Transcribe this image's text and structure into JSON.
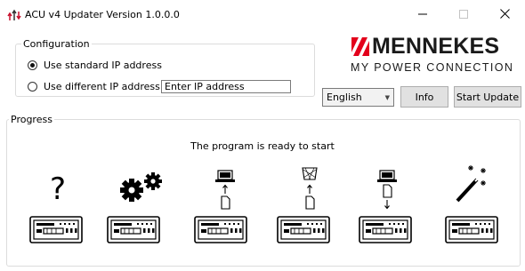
{
  "window": {
    "title": "ACU v4 Updater Version 1.0.0.0",
    "minimize_icon": "minimize-icon",
    "maximize_icon": "maximize-icon",
    "close_icon": "close-icon",
    "app_icon": "arrows-updater-icon"
  },
  "configuration": {
    "legend": "Configuration",
    "standard_ip_label": "Use standard IP address",
    "different_ip_label": "Use different IP address:",
    "ip_placeholder": "Enter IP address",
    "selected": "standard"
  },
  "brand": {
    "name": "MENNEKES",
    "tagline": "MY POWER CONNECTION",
    "logo_color": "#e3001b"
  },
  "controls": {
    "language": "English",
    "info_label": "Info",
    "start_label": "Start Update"
  },
  "progress": {
    "legend": "Progress",
    "status": "The program is ready to start",
    "steps": [
      {
        "icon": "question-mark-icon",
        "device": "controller-device-icon"
      },
      {
        "icon": "gears-icon",
        "device": "controller-device-icon"
      },
      {
        "icon": "laptop-upload-icon",
        "device": "controller-device-icon"
      },
      {
        "icon": "wastebasket-upload-icon",
        "device": "controller-device-icon"
      },
      {
        "icon": "laptop-download-icon",
        "device": "controller-device-icon"
      },
      {
        "icon": "magic-wand-icon",
        "device": "controller-device-icon"
      }
    ]
  }
}
